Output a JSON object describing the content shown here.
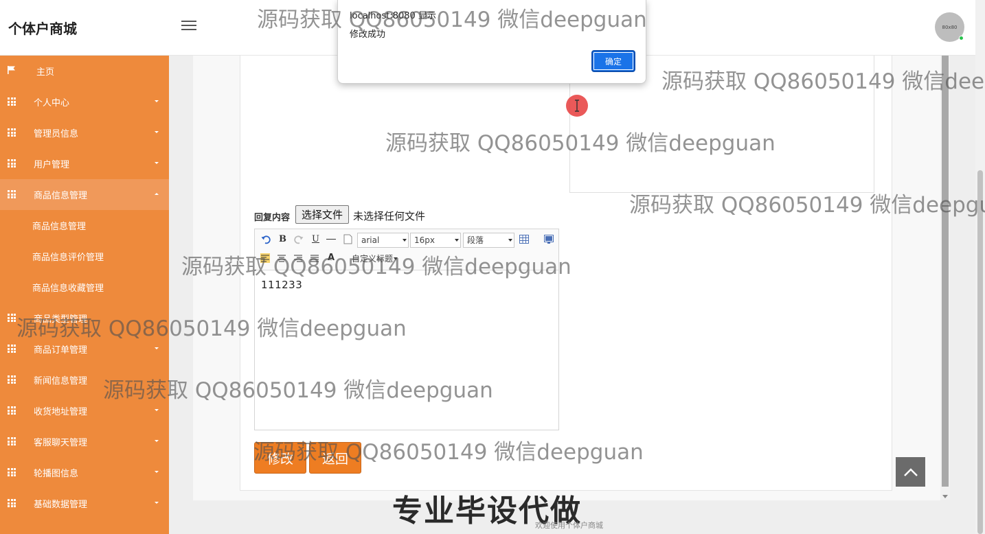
{
  "brand": "个体户商城",
  "avatar_text": "80x80",
  "sidebar": {
    "items": [
      {
        "label": "主页"
      },
      {
        "label": "个人中心"
      },
      {
        "label": "管理员信息"
      },
      {
        "label": "用户管理"
      },
      {
        "label": "商品信息管理"
      },
      {
        "label": "商品信息管理"
      },
      {
        "label": "商品信息评价管理"
      },
      {
        "label": "商品信息收藏管理"
      },
      {
        "label": "商品类型管理"
      },
      {
        "label": "商品订单管理"
      },
      {
        "label": "新闻信息管理"
      },
      {
        "label": "收货地址管理"
      },
      {
        "label": "客服聊天管理"
      },
      {
        "label": "轮播图信息"
      },
      {
        "label": "基础数据管理"
      }
    ]
  },
  "form": {
    "reply_label": "回复内容",
    "file_button": "选择文件",
    "file_status": "未选择任何文件",
    "editor_content": "111233",
    "font_family": "arial",
    "font_size": "16px",
    "paragraph": "段落",
    "custom_title": "自定义标题",
    "submit": "修改",
    "back": "返回"
  },
  "alert": {
    "title": "localhost:8080 显示",
    "message": "修改成功",
    "ok": "确定"
  },
  "footer": {
    "slogan": "专业毕设代做",
    "welcome": "欢迎使用个体户商城"
  },
  "watermark": "源码获取 QQ86050149 微信deepguan"
}
